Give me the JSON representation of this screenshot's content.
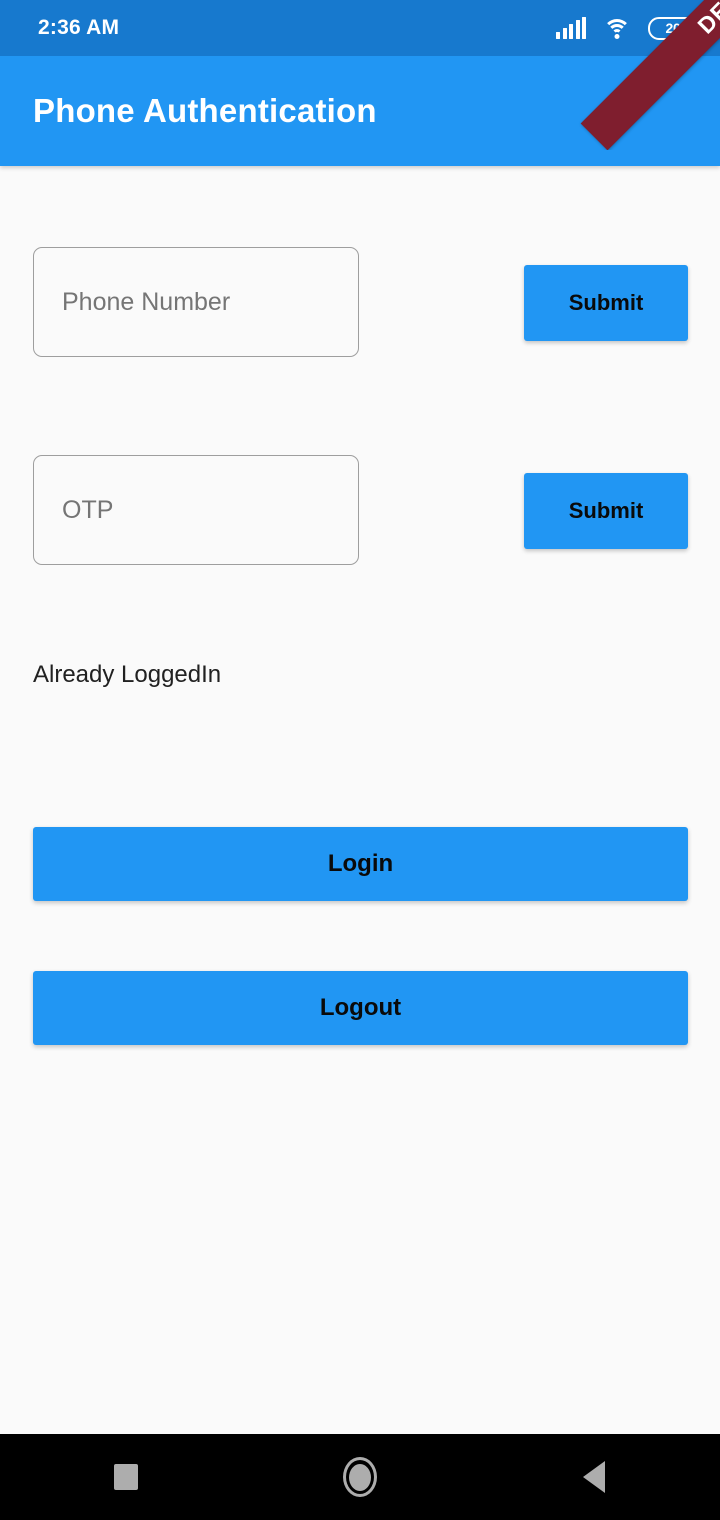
{
  "status_bar": {
    "time": "2:36 AM",
    "battery_level": "20",
    "icons": {
      "signal": "signal-bars-icon",
      "wifi": "wifi-icon",
      "battery": "battery-charging-icon"
    },
    "background_color": "#1779CE"
  },
  "debug_ribbon": {
    "label": "DEBUG",
    "color": "#7F1E2E"
  },
  "app_bar": {
    "title": "Phone Authentication",
    "background_color": "#2196F3",
    "text_color": "#FFFFFF"
  },
  "form": {
    "phone": {
      "placeholder": "Phone Number",
      "value": "",
      "submit_label": "Submit"
    },
    "otp": {
      "placeholder": "OTP",
      "value": "",
      "submit_label": "Submit"
    },
    "status_text": "Already LoggedIn",
    "login_label": "Login",
    "logout_label": "Logout",
    "button_color": "#2196F3",
    "button_text_color": "#0A0A0A"
  },
  "nav_bar": {
    "background_color": "#000000",
    "icon_color": "#ADADAD",
    "recents": "square-recents-icon",
    "home": "circle-home-icon",
    "back": "triangle-back-icon"
  },
  "page": {
    "background_color": "#FAFAFA"
  }
}
